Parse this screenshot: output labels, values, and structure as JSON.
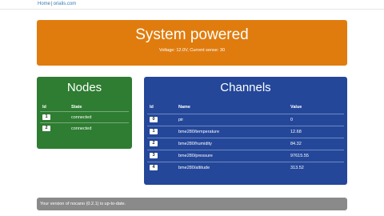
{
  "nav": {
    "home": "Home",
    "separator": "|",
    "site": "orialis.com"
  },
  "status": {
    "title": "System powered",
    "details": "Voltage: 12.0V, Current sense: 30",
    "color": "#e07c0e"
  },
  "nodes": {
    "title": "Nodes",
    "color": "#2e7d32",
    "headers": {
      "id": "Id",
      "state": "State"
    },
    "rows": [
      {
        "id": "1",
        "state": "connected"
      },
      {
        "id": "2",
        "state": "connected"
      }
    ]
  },
  "channels": {
    "title": "Channels",
    "color": "#24479a",
    "headers": {
      "id": "Id",
      "name": "Name",
      "value": "Value"
    },
    "rows": [
      {
        "id": "0",
        "name": "pir",
        "value": "0"
      },
      {
        "id": "1",
        "name": "bme280/temperature",
        "value": "12.68"
      },
      {
        "id": "2",
        "name": "bme280/humidity",
        "value": "84.32"
      },
      {
        "id": "3",
        "name": "bme280/pressure",
        "value": "97615.55"
      },
      {
        "id": "4",
        "name": "bme280/altitude",
        "value": "313.52"
      }
    ]
  },
  "footer": {
    "message": "Your version of nocano (0.2.1) is up-to-date."
  }
}
